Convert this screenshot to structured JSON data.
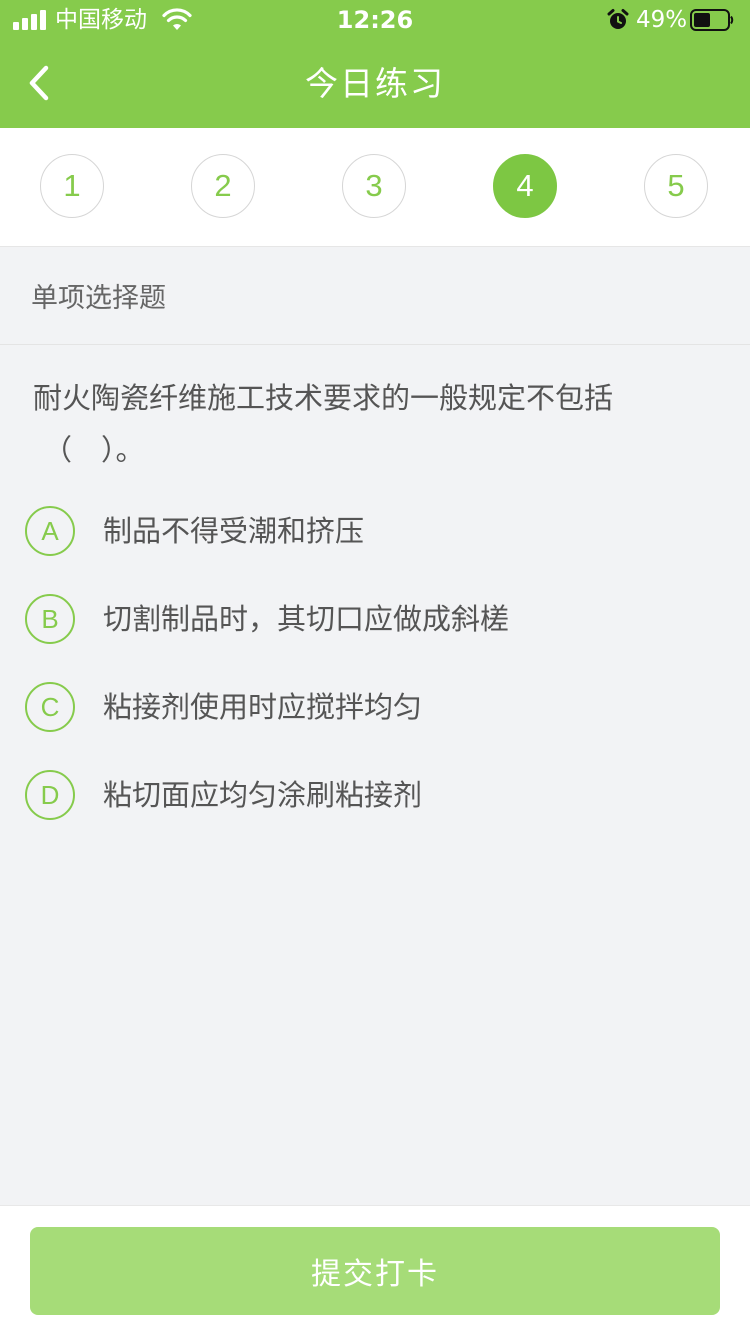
{
  "status_bar": {
    "carrier": "中国移动",
    "time": "12:26",
    "battery_percent": "49%",
    "battery_level": 0.49,
    "icons": [
      "signal-icon",
      "wifi-icon",
      "alarm-icon",
      "battery-icon"
    ]
  },
  "nav": {
    "back_icon": "chevron-left-icon",
    "title": "今日练习"
  },
  "question_numbers": {
    "items": [
      "1",
      "2",
      "3",
      "4",
      "5"
    ],
    "current": "4"
  },
  "question": {
    "type": "单项选择题",
    "stem": "耐火陶瓷纤维施工技术要求的一般规定不包括",
    "blank": "（　）。",
    "options": [
      {
        "letter": "A",
        "text": "制品不得受潮和挤压"
      },
      {
        "letter": "B",
        "text": "切割制品时，其切口应做成斜槎"
      },
      {
        "letter": "C",
        "text": "粘接剂使用时应搅拌均匀"
      },
      {
        "letter": "D",
        "text": "粘切面应均匀涂刷粘接剂"
      }
    ]
  },
  "footer": {
    "submit_label": "提交打卡"
  },
  "colors": {
    "brand": "#86cb4c",
    "active": "#7dc743",
    "button_disabled": "#a6dc78",
    "background": "#f2f3f5"
  }
}
